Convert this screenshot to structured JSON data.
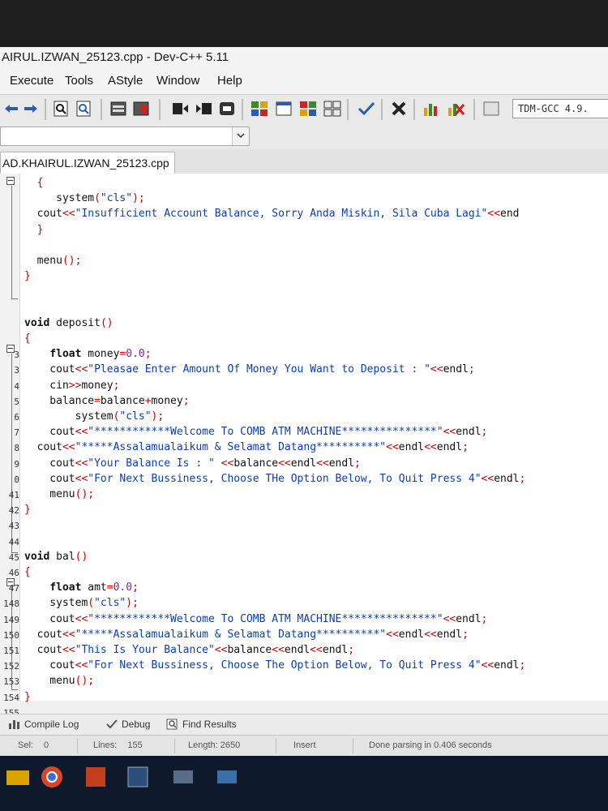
{
  "window": {
    "title": "AIRUL.IZWAN_25123.cpp - Dev-C++ 5.11"
  },
  "menu": {
    "items": [
      "Execute",
      "Tools",
      "AStyle",
      "Window",
      "Help"
    ]
  },
  "toolbar": {
    "compiler": "TDM-GCC 4.9."
  },
  "editor_tab": {
    "label": "AD.KHAIRUL.IZWAN_25123.cpp"
  },
  "code": {
    "lines": [
      {
        "n": "",
        "t": "  {"
      },
      {
        "n": "",
        "t": "     system(\"cls\");"
      },
      {
        "n": "",
        "t": "  cout<<\"Insufficient Account Balance, Sorry Anda Miskin, Sila Cuba Lagi\"<<end"
      },
      {
        "n": "",
        "t": "  }"
      },
      {
        "n": "",
        "t": ""
      },
      {
        "n": "",
        "t": "  menu();"
      },
      {
        "n": "",
        "t": "}"
      },
      {
        "n": "",
        "t": ""
      },
      {
        "n": "",
        "t": ""
      },
      {
        "n": "",
        "t": "void deposit()"
      },
      {
        "n": "",
        "t": "{"
      },
      {
        "n": "3",
        "t": "    float money=0.0;"
      },
      {
        "n": "3",
        "t": "    cout<<\"Pleasae Enter Amount Of Money You Want to Deposit : \"<<endl;"
      },
      {
        "n": "4",
        "t": "    cin>>money;"
      },
      {
        "n": "5",
        "t": "    balance=balance+money;"
      },
      {
        "n": "6",
        "t": "        system(\"cls\");"
      },
      {
        "n": "7",
        "t": "    cout<<\"************Welcome To COMB ATM MACHINE***************\"<<endl;"
      },
      {
        "n": "8",
        "t": "  cout<<\"*****Assalamualaikum & Selamat Datang**********\"<<endl<<endl;"
      },
      {
        "n": "9",
        "t": "    cout<<\"Your Balance Is : \" <<balance<<endl<<endl;"
      },
      {
        "n": "0",
        "t": "    cout<<\"For Next Bussiness, Choose THe Option Below, To Quit Press 4\"<<endl;"
      },
      {
        "n": "41",
        "t": "    menu();"
      },
      {
        "n": "42",
        "t": "}"
      },
      {
        "n": "43",
        "t": ""
      },
      {
        "n": "44",
        "t": ""
      },
      {
        "n": "45",
        "t": "void bal()"
      },
      {
        "n": "46",
        "t": "{"
      },
      {
        "n": "47",
        "t": "    float amt=0.0;"
      },
      {
        "n": "148",
        "t": "    system(\"cls\");"
      },
      {
        "n": "149",
        "t": "    cout<<\"************Welcome To COMB ATM MACHINE***************\"<<endl;"
      },
      {
        "n": "150",
        "t": "  cout<<\"*****Assalamualaikum & Selamat Datang**********\"<<endl<<endl;"
      },
      {
        "n": "151",
        "t": "  cout<<\"This Is Your Balance\"<<balance<<endl<<endl;"
      },
      {
        "n": "152",
        "t": "    cout<<\"For Next Bussiness, Choose The Option Below, To Quit Press 4\"<<endl;"
      },
      {
        "n": "153",
        "t": "    menu();"
      },
      {
        "n": "154",
        "t": "}"
      },
      {
        "n": "155",
        "t": ""
      }
    ]
  },
  "bottom_tabs": {
    "compile_log": "Compile Log",
    "debug": "Debug",
    "find_results": "Find Results"
  },
  "status": {
    "sel_label": "Sel:",
    "sel_value": "0",
    "lines_label": "Lines:",
    "lines_value": "155",
    "length_label": "Length:",
    "length_value": "2650",
    "mode": "Insert",
    "message": "Done parsing in 0.406 seconds"
  }
}
